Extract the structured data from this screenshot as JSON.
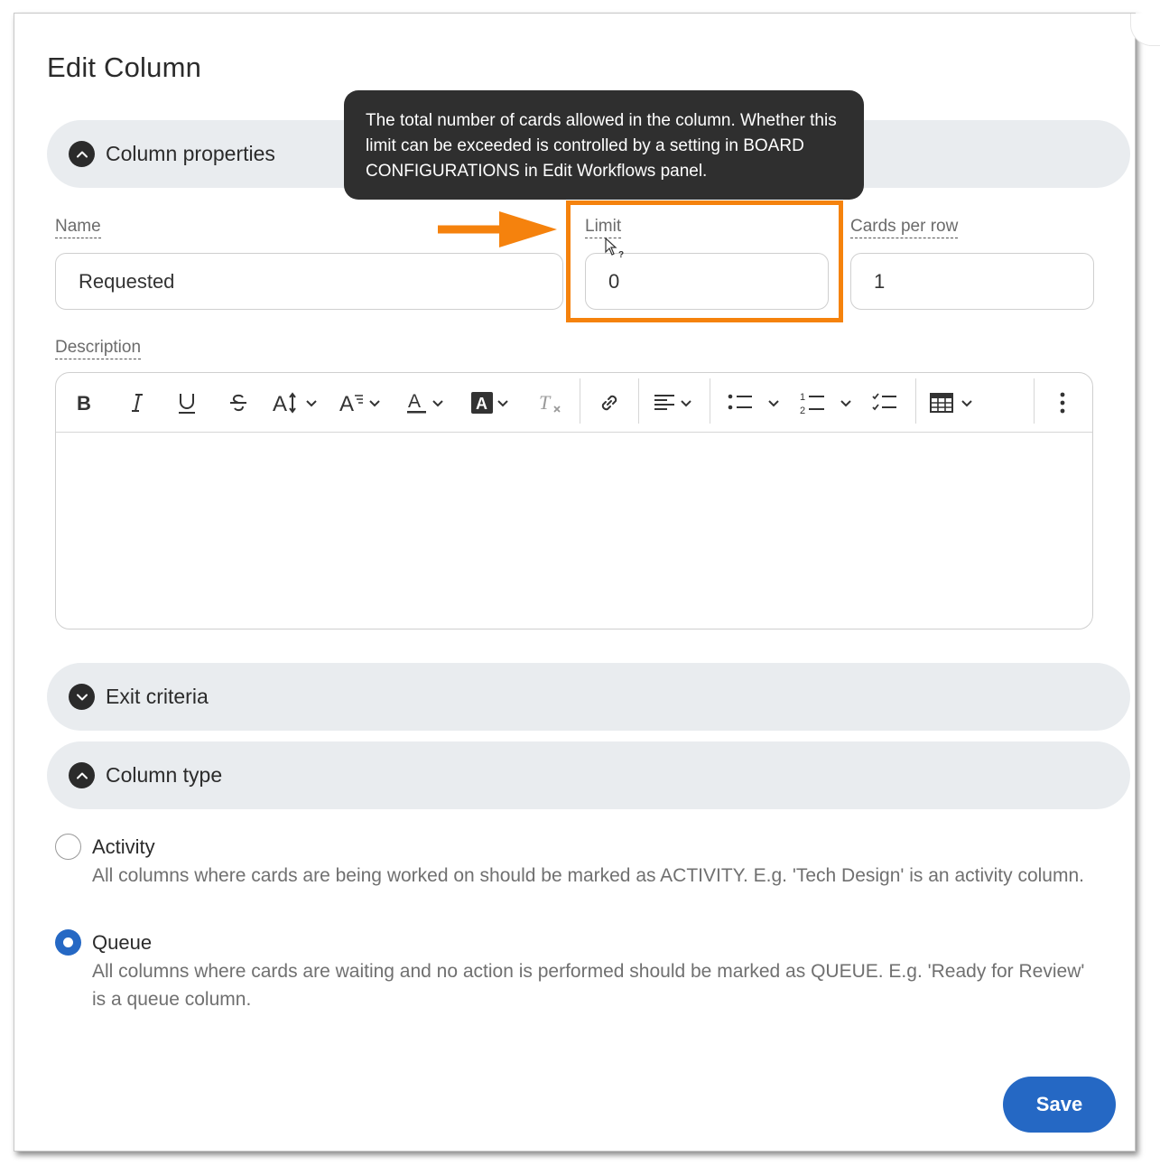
{
  "dialog": {
    "title": "Edit Column"
  },
  "sections": {
    "column_properties": "Column properties",
    "exit_criteria": "Exit criteria",
    "column_type": "Column type"
  },
  "tooltip": {
    "text": "The total number of cards allowed in the column. Whether this limit can be exceeded is controlled by a setting in BOARD CONFIGURATIONS in Edit Workflows panel."
  },
  "fields": {
    "name": {
      "label": "Name",
      "value": "Requested"
    },
    "limit": {
      "label": "Limit",
      "value": "0"
    },
    "cards_per_row": {
      "label": "Cards per row",
      "value": "1"
    },
    "description": {
      "label": "Description",
      "value": ""
    }
  },
  "editor_toolbar": [
    "bold-icon",
    "italic-icon",
    "underline-icon",
    "strikethrough-icon",
    "font-size-icon",
    "font-family-icon",
    "text-color-icon",
    "highlight-icon",
    "clear-format-icon",
    "link-icon",
    "align-icon",
    "bullet-list-icon",
    "numbered-list-icon",
    "checklist-icon",
    "table-icon",
    "more-icon"
  ],
  "column_type": {
    "options": [
      {
        "title": "Activity",
        "description": "All columns where cards are being worked on should be marked as ACTIVITY. E.g. 'Tech Design' is an activity column.",
        "selected": false
      },
      {
        "title": "Queue",
        "description": "All columns where cards are waiting and no action is performed should be marked as QUEUE. E.g. 'Ready for Review' is a queue column.",
        "selected": true
      }
    ]
  },
  "actions": {
    "save_label": "Save"
  },
  "colors": {
    "accent": "#2568c4",
    "annotation": "#f5820d",
    "tooltip_bg": "#2f2f2f",
    "section_bg": "#e9ecef"
  }
}
